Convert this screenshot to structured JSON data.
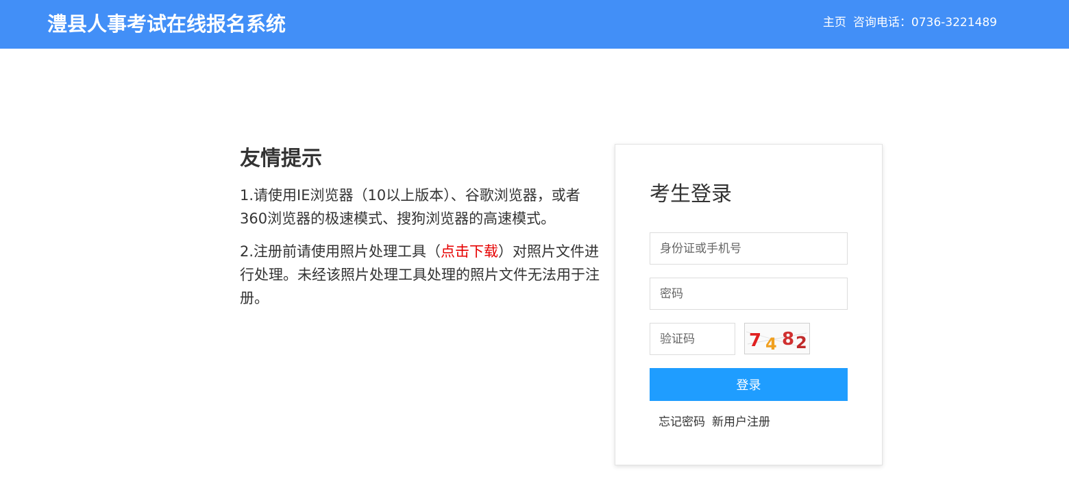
{
  "header": {
    "title": "澧县人事考试在线报名系统",
    "home_link": "主页",
    "phone": "咨询电话：0736-3221489",
    "bg_color": "#428ff7"
  },
  "notice": {
    "title": "友情提示",
    "item1": "1.请使用IE浏览器（10以上版本）、谷歌浏览器，或者360浏览器的极速模式、搜狗浏览器的高速模式。",
    "item2_prefix": "2.注册前请使用照片处理工具（",
    "item2_link": "点击下载",
    "item2_suffix": "）对照片文件进行处理。未经该照片处理工具处理的照片文件无法用于注册。",
    "link_color": "#e60000"
  },
  "login": {
    "title": "考生登录",
    "id_placeholder": "身份证或手机号",
    "id_value": "",
    "password_placeholder": "密码",
    "password_value": "",
    "captcha_placeholder": "验证码",
    "captcha_value": "",
    "captcha_code": "7482",
    "captcha_colors": [
      "#e02020",
      "#f0a020",
      "#d03030",
      "#c02a2a"
    ],
    "submit_label": "登录",
    "submit_color": "#1f9dff",
    "forgot_link": "忘记密码",
    "register_link": "新用户注册"
  }
}
